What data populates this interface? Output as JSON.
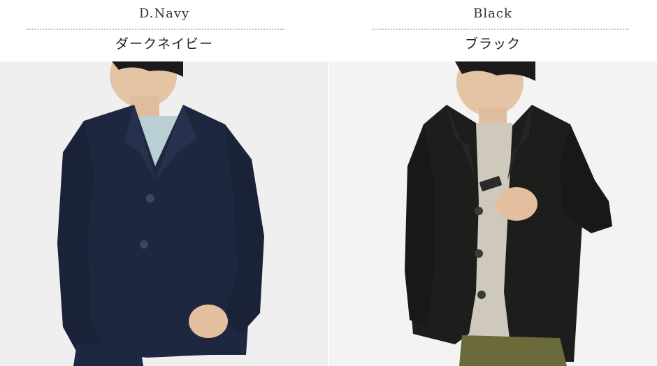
{
  "products": [
    {
      "color_en": "D.Navy",
      "color_jp": "ダークネイビー",
      "jacket_color": "#1e2740",
      "shirt_color": "#b9cfd3"
    },
    {
      "color_en": "Black",
      "color_jp": "ブラック",
      "jacket_color": "#1d1e1c",
      "shirt_color": "#cfc8bc"
    }
  ],
  "colors": {
    "background": "#ffffff",
    "divider": "#bdbdbd",
    "photo_background_left": "#efefef",
    "photo_background_right": "#f3f3f3"
  }
}
